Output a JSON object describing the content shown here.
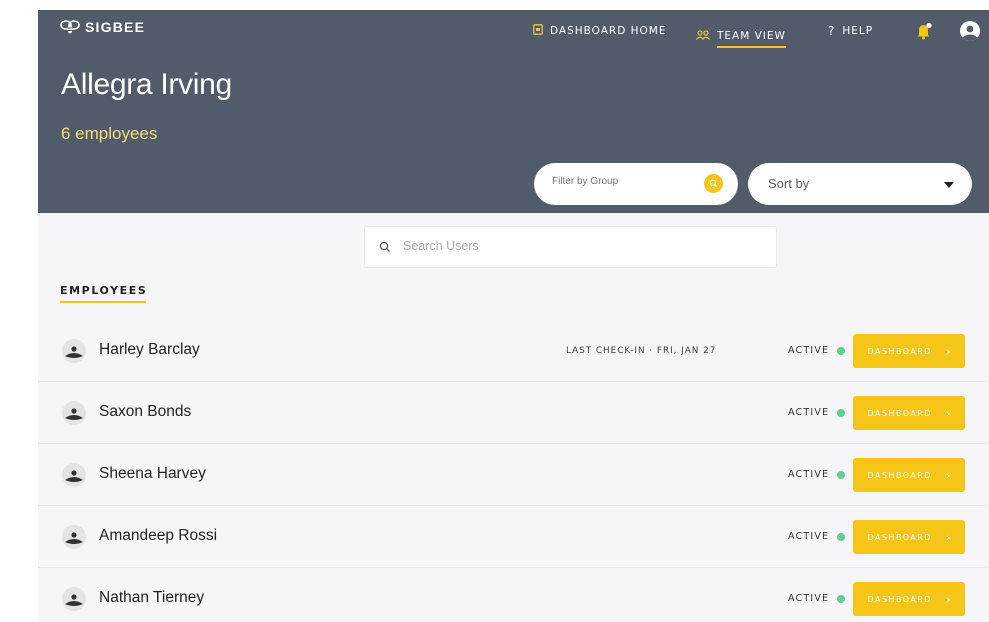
{
  "brand": {
    "name": "SIGBEE"
  },
  "nav": {
    "items": [
      {
        "label": "DASHBOARD HOME",
        "icon": "dashboard-icon",
        "active": false
      },
      {
        "label": "TEAM VIEW",
        "icon": "team-icon",
        "active": true
      },
      {
        "label": "HELP",
        "icon": "question-icon",
        "active": false
      }
    ],
    "help_glyph": "?"
  },
  "header": {
    "title": "Allegra Irving",
    "subtitle": "6 employees",
    "filter_placeholder": "Filter by Group",
    "sort_label": "Sort by"
  },
  "search": {
    "placeholder": "Search Users"
  },
  "section": {
    "title": "EMPLOYEES"
  },
  "employees": [
    {
      "name": "Harley Barclay",
      "last_checkin": "LAST CHECK-IN · FRI, JAN 27",
      "status": "ACTIVE",
      "button": "DASHBOARD",
      "chevron": "›"
    },
    {
      "name": "Saxon Bonds",
      "last_checkin": "",
      "status": "ACTIVE",
      "button": "DASHBOARD",
      "chevron": "›"
    },
    {
      "name": "Sheena Harvey",
      "last_checkin": "",
      "status": "ACTIVE",
      "button": "DASHBOARD",
      "chevron": "›"
    },
    {
      "name": "Amandeep Rossi",
      "last_checkin": "",
      "status": "ACTIVE",
      "button": "DASHBOARD",
      "chevron": "›"
    },
    {
      "name": "Nathan Tierney",
      "last_checkin": "",
      "status": "ACTIVE",
      "button": "DASHBOARD",
      "chevron": "›"
    }
  ],
  "colors": {
    "header_bg": "#525b69",
    "accent": "#f5c518",
    "subtitle": "#f3dd7f",
    "active_dot": "#5fd08b",
    "page_bg": "#f6f6f9"
  }
}
